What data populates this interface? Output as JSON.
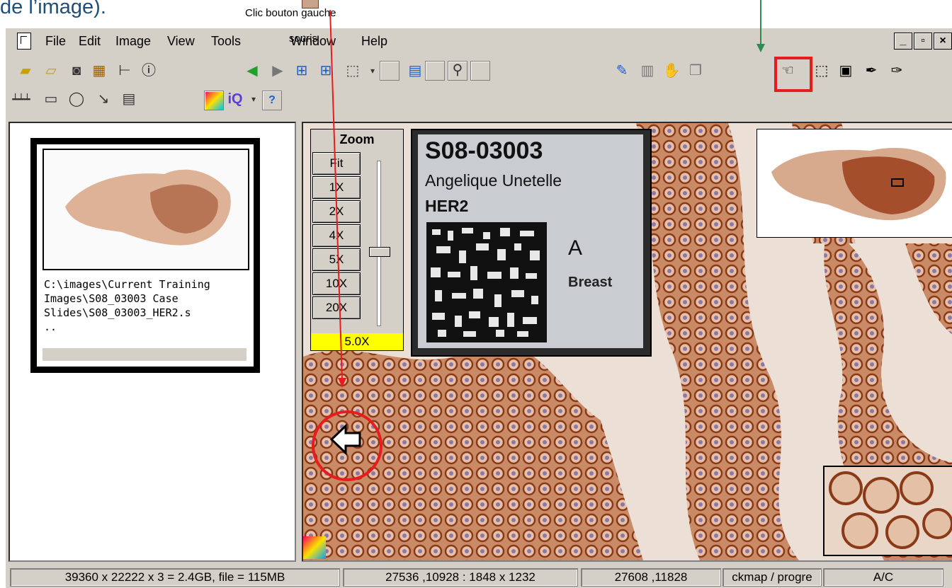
{
  "annotation": {
    "top_caption": "de l’image).",
    "click_caption": "Clic bouton gauche",
    "click_caption_2": "souris",
    "accent": "#e81c1c",
    "arrow_green": "#2e8b57"
  },
  "menu": {
    "items": [
      "File",
      "Edit",
      "Image",
      "View",
      "Tools",
      "Window",
      "Help"
    ]
  },
  "window_buttons": {
    "minimize": "_",
    "maximize": "▫",
    "close": "×"
  },
  "toolbar1": [
    "open-folder-icon",
    "open-file-icon",
    "camera-icon",
    "filter-icon",
    "chart-icon",
    "info-icon",
    "back-icon",
    "forward-icon",
    "tree-icon",
    "tree2-icon",
    "select-region-icon",
    "dropdown-icon",
    "download-icon",
    "doc-icon",
    "image-compare-icon",
    "zoom-icon",
    "panel-icon",
    "edit-icon",
    "stack-icon",
    "stamp-icon",
    "copy-icon",
    "pan-hand-icon",
    "select-arrow-icon",
    "save-select-icon",
    "pen-icon",
    "pen2-icon"
  ],
  "toolbar2": [
    "ruler-icon",
    "rectangle-icon",
    "ellipse-icon",
    "arrow-icon",
    "text-icon",
    "color-icon",
    "iq-icon",
    "dropdown-icon",
    "help-icon"
  ],
  "thumbnail": {
    "path": "C:\\images\\Current Training\nImages\\S08_03003 Case\nSlides\\S08_03003_HER2.s\n.."
  },
  "zoom": {
    "title": "Zoom",
    "buttons": [
      "Fit",
      "1X",
      "2X",
      "4X",
      "5X",
      "10X",
      "20X"
    ],
    "readout": "5.0X",
    "level_fraction": 0.55
  },
  "slide_label": {
    "slide_id": "S08-03003",
    "patient": "Angelique Unetelle",
    "stain": "HER2",
    "block": "A",
    "tissue": "Breast"
  },
  "status": {
    "dimensions": "39360 x 22222 x 3 = 2.4GB, file = 115MB",
    "region": "27536 ,10928 : 1848 x 1232",
    "cursor": "27608 ,11828",
    "map": "ckmap / progre",
    "mode": "A/C"
  }
}
